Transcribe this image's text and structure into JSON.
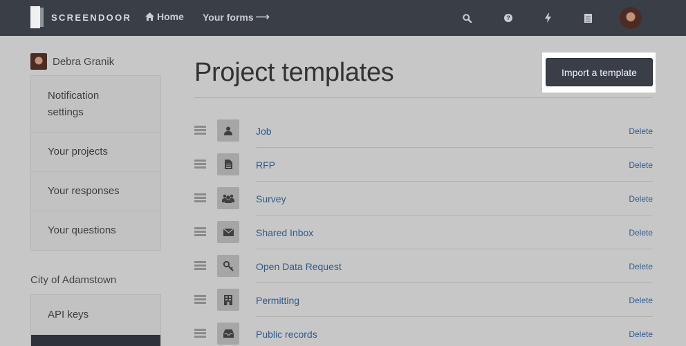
{
  "app": {
    "name": "SCREENDOOR"
  },
  "nav": {
    "home": "Home",
    "forms": "Your forms"
  },
  "top_icons": [
    "search-icon",
    "help-icon",
    "bolt-icon",
    "document-icon"
  ],
  "sidebar": {
    "user_name": "Debra Granik",
    "items": [
      {
        "label": "Notification settings"
      },
      {
        "label": "Your projects"
      },
      {
        "label": "Your responses"
      },
      {
        "label": "Your questions"
      }
    ],
    "org_name": "City of Adamstown",
    "org_items": [
      {
        "label": "API keys"
      }
    ]
  },
  "main": {
    "title": "Project templates",
    "import_label": "Import a template",
    "templates": [
      {
        "name": "Job",
        "icon": "user-icon",
        "delete": "Delete"
      },
      {
        "name": "RFP",
        "icon": "document-icon",
        "delete": "Delete"
      },
      {
        "name": "Survey",
        "icon": "group-icon",
        "delete": "Delete"
      },
      {
        "name": "Shared Inbox",
        "icon": "envelope-icon",
        "delete": "Delete"
      },
      {
        "name": "Open Data Request",
        "icon": "key-icon",
        "delete": "Delete"
      },
      {
        "name": "Permitting",
        "icon": "building-icon",
        "delete": "Delete"
      },
      {
        "name": "Public records",
        "icon": "inbox-icon",
        "delete": "Delete"
      }
    ]
  },
  "colors": {
    "topbar": "#3a3f47",
    "link": "#2e5a8c",
    "overlay": "#c7c7c7"
  }
}
